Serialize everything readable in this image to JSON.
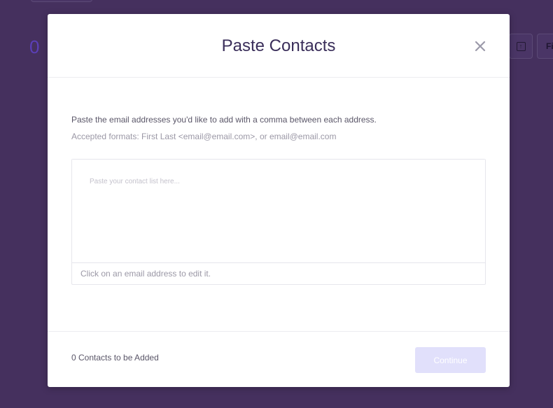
{
  "background": {
    "contact_count": "0",
    "filter_button_label": "Fi",
    "upload_icon": "upload-icon"
  },
  "modal": {
    "title": "Paste Contacts",
    "close_icon": "close-icon",
    "instructions": "Paste the email addresses you'd like to add with a comma between each address.",
    "formats": "Accepted formats: First Last <email@email.com>, or email@email.com",
    "textarea": {
      "placeholder": "Paste your contact list here...",
      "value": ""
    },
    "edit_hint": "Click on an email address to edit it.",
    "footer": {
      "count_text": "0 Contacts to be Added",
      "continue_label": "Continue"
    }
  },
  "colors": {
    "overlay": "#45305e",
    "title": "#3a2e5a",
    "continue_disabled": "#e1e0fb",
    "count_accent": "#5b3fb8"
  }
}
